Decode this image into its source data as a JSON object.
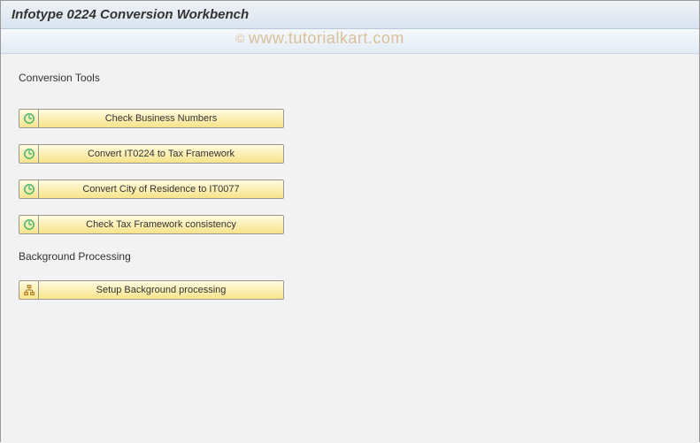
{
  "header": {
    "title": "Infotype 0224 Conversion Workbench"
  },
  "watermark": "www.tutorialkart.com",
  "sections": {
    "tools_label": "Conversion Tools",
    "bg_label": "Background Processing"
  },
  "buttons": {
    "check_business_numbers": "Check Business Numbers",
    "convert_it0224": "Convert IT0224 to Tax Framework",
    "convert_city": "Convert City of Residence to IT0077",
    "check_tax_consistency": "Check Tax Framework consistency",
    "setup_bg": "Setup Background processing"
  }
}
